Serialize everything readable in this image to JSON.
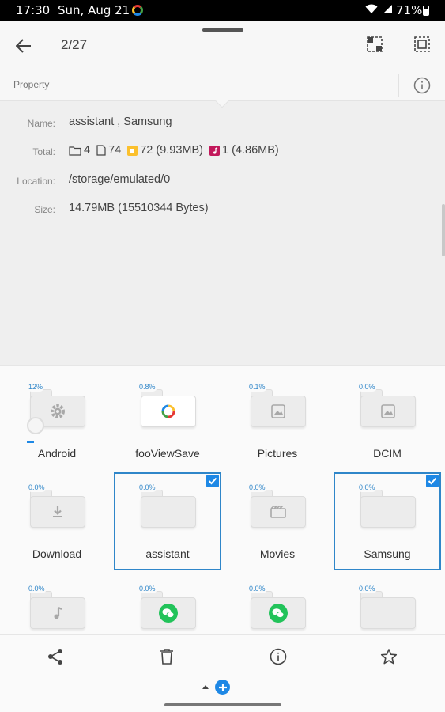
{
  "status_bar": {
    "time": "17:30",
    "date": "Sun, Aug 21",
    "battery": "71%"
  },
  "header": {
    "counter": "2/27"
  },
  "property_panel": {
    "tab_label": "Property",
    "name_label": "Name:",
    "name_value": "assistant , Samsung",
    "total_label": "Total:",
    "total_folders": "4",
    "total_files": "74",
    "total_images": "72 (9.93MB)",
    "total_audio": "1 (4.86MB)",
    "location_label": "Location:",
    "location_value": "/storage/emulated/0",
    "size_label": "Size:",
    "size_value": "14.79MB (15510344 Bytes)"
  },
  "folders": [
    {
      "name": "Android",
      "percent": "12%",
      "icon": "gear-icon",
      "selected": false
    },
    {
      "name": "fooViewSave",
      "percent": "0.8%",
      "icon": "fooview-logo-icon",
      "selected": false
    },
    {
      "name": "Pictures",
      "percent": "0.1%",
      "icon": "image-icon",
      "selected": false
    },
    {
      "name": "DCIM",
      "percent": "0.0%",
      "icon": "image-icon",
      "selected": false
    },
    {
      "name": "Download",
      "percent": "0.0%",
      "icon": "download-icon",
      "selected": false
    },
    {
      "name": "assistant",
      "percent": "0.0%",
      "icon": "none",
      "selected": true
    },
    {
      "name": "Movies",
      "percent": "0.0%",
      "icon": "film-icon",
      "selected": false
    },
    {
      "name": "Samsung",
      "percent": "0.0%",
      "icon": "none",
      "selected": true
    },
    {
      "name": "",
      "percent": "0.0%",
      "icon": "music-icon",
      "selected": false
    },
    {
      "name": "",
      "percent": "0.0%",
      "icon": "wechat-icon",
      "selected": false
    },
    {
      "name": "",
      "percent": "0.0%",
      "icon": "wechat-icon",
      "selected": false
    },
    {
      "name": "",
      "percent": "0.0%",
      "icon": "none",
      "selected": false
    }
  ],
  "bottom_actions": [
    "share-icon",
    "delete-icon",
    "info-icon",
    "star-icon"
  ],
  "colors": {
    "accent": "#1e88e5",
    "selection_border": "#2f86c9",
    "image_badge": "#fbc02d",
    "audio_badge": "#c2185b",
    "wechat": "#22c35a"
  }
}
